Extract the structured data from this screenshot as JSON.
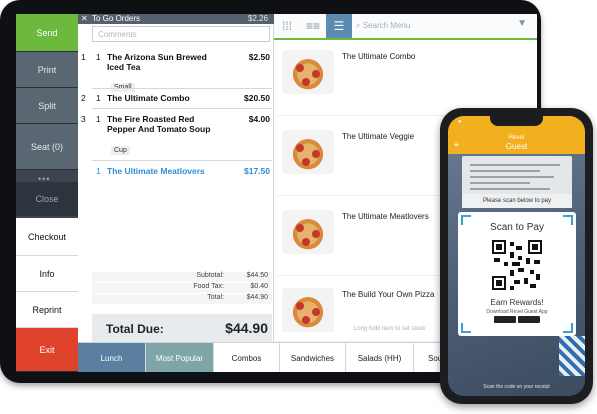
{
  "actions": {
    "send": "Send",
    "print": "Print",
    "split": "Split",
    "seat": "Seat (0)",
    "close": "Close",
    "checkout": "Checkout",
    "info": "Info",
    "reprint": "Reprint",
    "exit": "Exit"
  },
  "order": {
    "title": "To Go Orders",
    "header_amount": "$2.26",
    "comments_placeholder": "Comments",
    "lines": [
      {
        "seq": "1",
        "qty": "1",
        "name": "The Arizona Sun Brewed Iced Tea",
        "price": "$2.50",
        "modifier": "Small"
      },
      {
        "seq": "2",
        "qty": "1",
        "name": "The Ultimate Combo",
        "price": "$20.50",
        "modifier": ""
      },
      {
        "seq": "3",
        "qty": "1",
        "name": "The Fire Roasted Red Pepper And Tomato Soup",
        "price": "$4.00",
        "modifier": "Cup"
      },
      {
        "seq": "",
        "qty": "1",
        "name": "The Ultimate Meatlovers",
        "price": "$17.50",
        "modifier": ""
      }
    ],
    "subtotal_label": "Subtotal:",
    "subtotal": "$44.50",
    "food_tax_label": "Food Tax:",
    "food_tax": "$0.40",
    "total_label": "Total:",
    "total": "$44.90",
    "due_label": "Total Due:",
    "due": "$44.90"
  },
  "menu": {
    "search_placeholder": "Search Menu",
    "items": [
      "The Ultimate Combo",
      "The Ultimate Veggie",
      "The Ultimate Meatlovers",
      "The Build Your Own Pizza"
    ],
    "hint": "Long hold item to set stock"
  },
  "categories": [
    "Lunch",
    "Most Popular",
    "Combos",
    "Sandwiches",
    "Salads (HH)",
    "Sou"
  ],
  "phone": {
    "brand": "Revel",
    "title": "Guest",
    "receipt_pay": "Please scan below to pay",
    "scan_to_pay": "Scan to Pay",
    "earn": "Earn Rewards!",
    "download": "Download Revel Guest App",
    "footer": "Scan the code on your receipt"
  },
  "colors": {
    "send_green": "#6cb93e",
    "exit_red": "#e0432c",
    "brand_yellow": "#f2b01e",
    "highlight_blue": "#2c8ed6"
  }
}
